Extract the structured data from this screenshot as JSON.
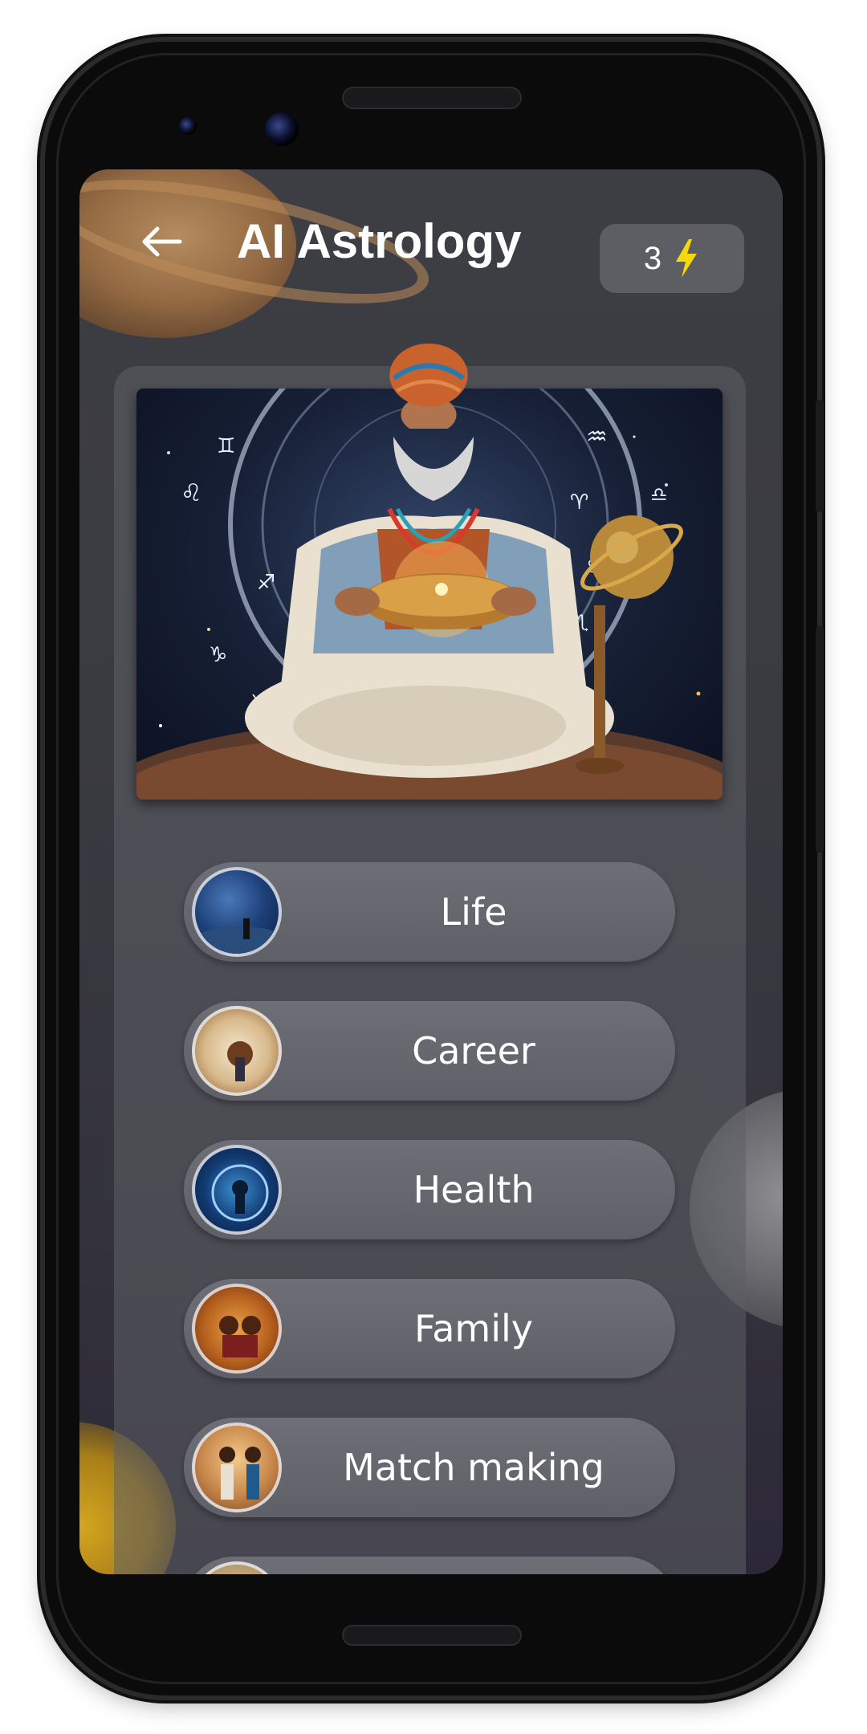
{
  "header": {
    "back_icon": "arrow-left-icon",
    "title": "AI Astrology",
    "credits": {
      "count": "3",
      "icon": "lightning-bolt-icon",
      "icon_color": "#f5d90a"
    }
  },
  "hero": {
    "image": "astrologer-illustration"
  },
  "topics": [
    {
      "label": "Life",
      "icon": "life-thumbnail"
    },
    {
      "label": "Career",
      "icon": "career-thumbnail"
    },
    {
      "label": "Health",
      "icon": "health-thumbnail"
    },
    {
      "label": "Family",
      "icon": "family-thumbnail"
    },
    {
      "label": "Match making",
      "icon": "match-making-thumbnail"
    },
    {
      "label": "",
      "icon": "partial-thumbnail"
    }
  ],
  "colors": {
    "screen_bg": "#3d3e44",
    "button_bg": "#6e6f76",
    "credits_bg": "#5d5e64",
    "accent": "#f5d90a"
  }
}
